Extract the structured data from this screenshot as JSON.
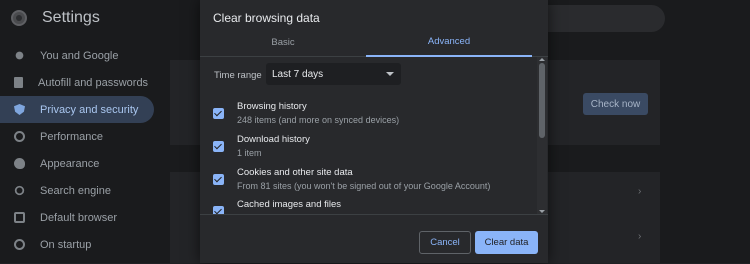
{
  "settings": {
    "title": "Settings",
    "check_now_label": "Check now",
    "sidebar": [
      {
        "label": "You and Google",
        "icon": "user-icon"
      },
      {
        "label": "Autofill and passwords",
        "icon": "document-icon"
      },
      {
        "label": "Privacy and security",
        "icon": "shield-icon"
      },
      {
        "label": "Performance",
        "icon": "gauge-icon"
      },
      {
        "label": "Appearance",
        "icon": "palette-icon"
      },
      {
        "label": "Search engine",
        "icon": "search-icon"
      },
      {
        "label": "Default browser",
        "icon": "browser-icon"
      },
      {
        "label": "On startup",
        "icon": "power-icon"
      }
    ],
    "active_index": 2
  },
  "dialog": {
    "title": "Clear browsing data",
    "tabs": [
      "Basic",
      "Advanced"
    ],
    "active_tab": "Advanced",
    "time_range_label": "Time range",
    "time_range_value": "Last 7 days",
    "options": [
      {
        "title": "Browsing history",
        "subtitle": "248 items (and more on synced devices)",
        "checked": true
      },
      {
        "title": "Download history",
        "subtitle": "1 item",
        "checked": true
      },
      {
        "title": "Cookies and other site data",
        "subtitle": "From 81 sites (you won't be signed out of your Google Account)",
        "checked": true
      },
      {
        "title": "Cached images and files",
        "subtitle": "",
        "checked": true
      }
    ],
    "cancel_label": "Cancel",
    "clear_label": "Clear data"
  },
  "colors": {
    "accent": "#8ab4f8",
    "dialog_bg": "#28292c",
    "page_bg": "#202124"
  }
}
